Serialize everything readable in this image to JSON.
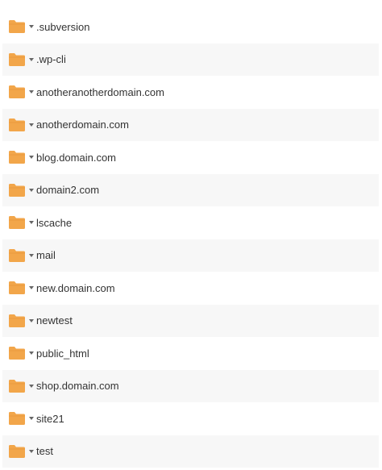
{
  "folders": [
    {
      "name": ".subversion",
      "icon": "folder-icon"
    },
    {
      "name": ".wp-cli",
      "icon": "folder-icon"
    },
    {
      "name": "anotheranotherdomain.com",
      "icon": "folder-icon"
    },
    {
      "name": "anotherdomain.com",
      "icon": "folder-icon"
    },
    {
      "name": "blog.domain.com",
      "icon": "folder-icon"
    },
    {
      "name": "domain2.com",
      "icon": "folder-icon"
    },
    {
      "name": "lscache",
      "icon": "folder-icon"
    },
    {
      "name": "mail",
      "icon": "folder-icon"
    },
    {
      "name": "new.domain.com",
      "icon": "folder-icon"
    },
    {
      "name": "newtest",
      "icon": "folder-icon"
    },
    {
      "name": "public_html",
      "icon": "folder-icon"
    },
    {
      "name": "shop.domain.com",
      "icon": "folder-icon"
    },
    {
      "name": "site21",
      "icon": "folder-icon"
    },
    {
      "name": "test",
      "icon": "folder-icon"
    }
  ],
  "colors": {
    "folder": "#f2a64a",
    "folder_tab": "#e8953a",
    "row_alt": "#f7f7f7",
    "text": "#333333"
  }
}
